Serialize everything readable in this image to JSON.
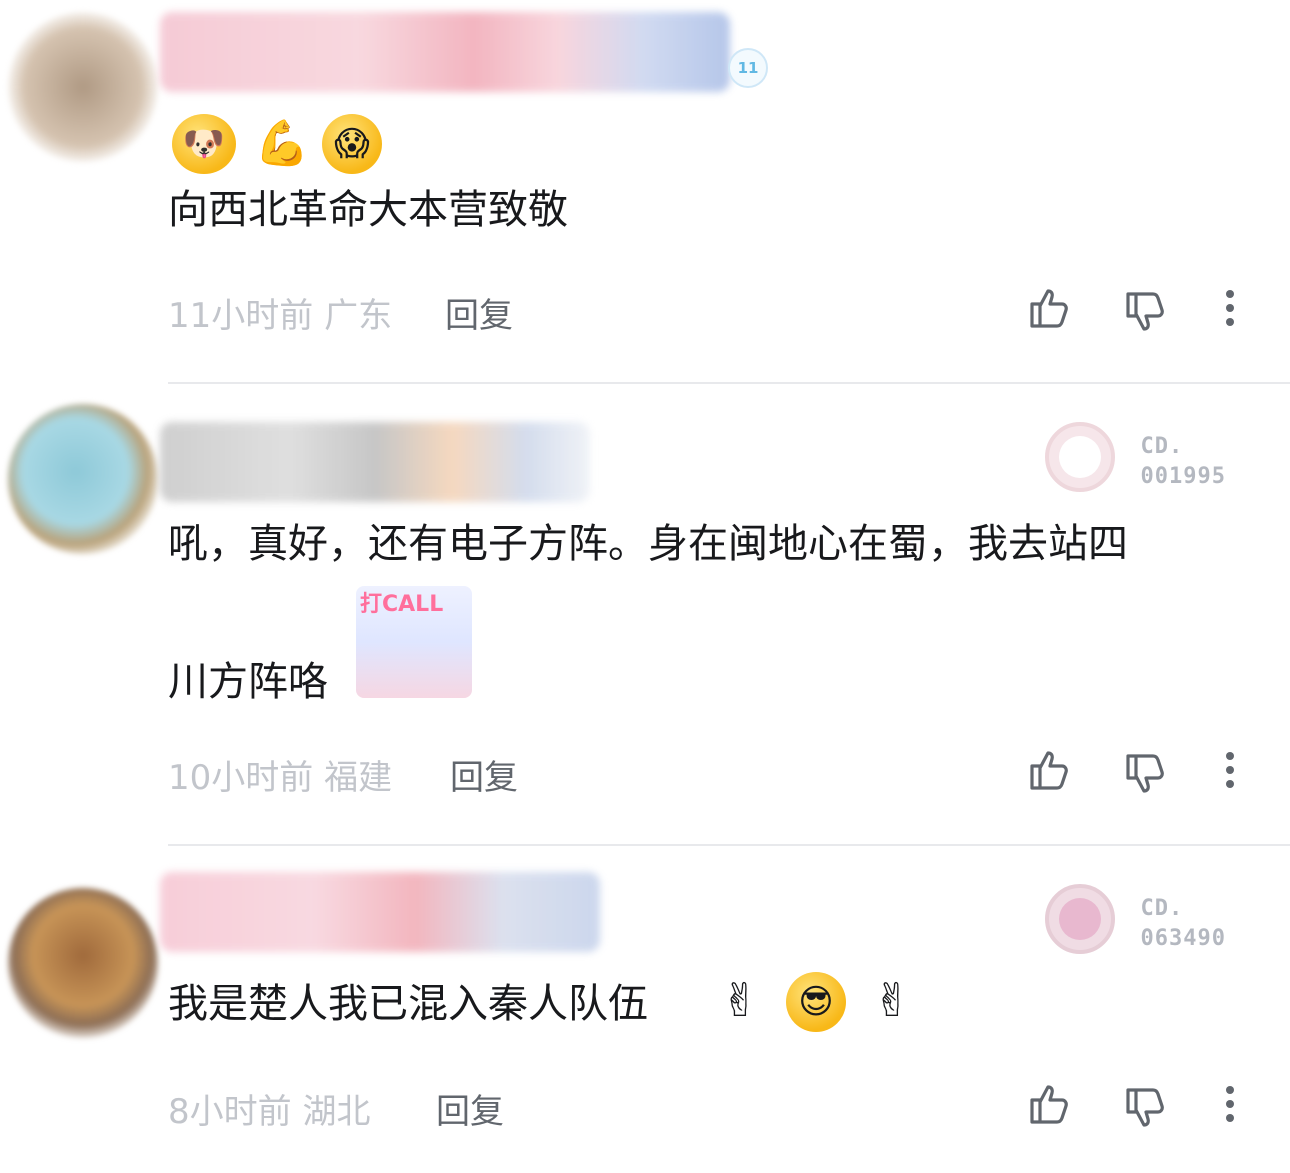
{
  "comments": [
    {
      "level": "11",
      "emojis": [
        "dog-with-rose-emoji",
        "flexed-bicep-emoji",
        "shocked-face-emoji"
      ],
      "text": "向西北革命大本营致敬",
      "time": "11小时前",
      "location": "广东",
      "reply_label": "回复"
    },
    {
      "fan_badge_label": "CD.",
      "fan_badge_no": "001995",
      "text_line1": "吼，真好，还有电子方阵。身在闽地心在蜀，我去站四",
      "text_line2": "川方阵咯",
      "sticker_caption": "打CALL",
      "time": "10小时前",
      "location": "福建",
      "reply_label": "回复"
    },
    {
      "fan_badge_label": "CD.",
      "fan_badge_no": "063490",
      "text": "我是楚人我已混入秦人队伍",
      "emojis": [
        "victory-hand-emoji",
        "cool-sunglasses-emoji",
        "victory-hand-emoji"
      ],
      "time": "8小时前",
      "location": "湖北",
      "reply_label": "回复"
    }
  ],
  "icons": {
    "like": "thumb-up-icon",
    "dislike": "thumb-down-icon",
    "more": "more-vertical-icon"
  }
}
